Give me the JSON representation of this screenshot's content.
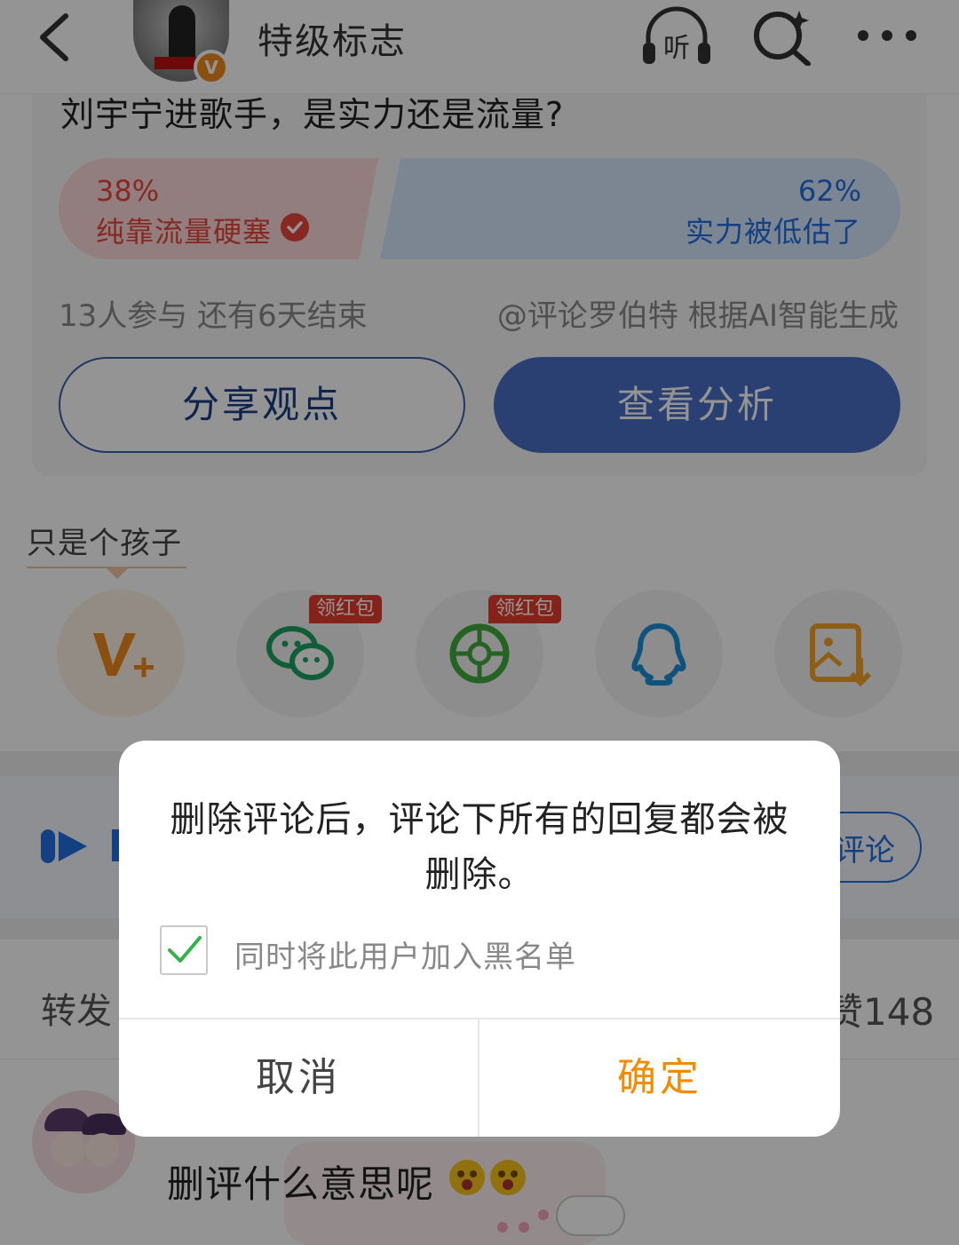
{
  "header": {
    "title": "特级标志",
    "avatar_badge": "V",
    "icons": [
      "back-icon",
      "listen-icon",
      "search-icon",
      "more-icon"
    ],
    "listen_label": "听"
  },
  "poll": {
    "question": "刘宇宁进歌手，是实力还是流量?",
    "left_option": {
      "percent": "38%",
      "label": "纯靠流量硬塞",
      "color": "#e8463c",
      "selected": true
    },
    "right_option": {
      "percent": "62%",
      "label": "实力被低估了",
      "color": "#1f6fe0"
    },
    "participants": "13人参与  还有6天结束",
    "source": "@评论罗伯特 根据AI智能生成",
    "share_button": "分享观点",
    "analysis_button": "查看分析"
  },
  "share": {
    "label": "只是个孩子",
    "redpack_label": "领红包",
    "targets": [
      "weibo-vplus-icon",
      "wechat-icon",
      "moments-icon",
      "qq-icon",
      "save-image-icon"
    ]
  },
  "background_bar": {
    "comment_pill_text": "评论"
  },
  "counts": {
    "forward_label": "转发",
    "like_label": "赞148"
  },
  "comment": {
    "text": "删评什么意思呢"
  },
  "dialog": {
    "message": "删除评论后，评论下所有的回复都会被删除。",
    "checkbox_label": "同时将此用户加入黑名单",
    "checkbox_checked": true,
    "cancel_label": "取消",
    "confirm_label": "确定",
    "confirm_color": "#f48a00"
  }
}
